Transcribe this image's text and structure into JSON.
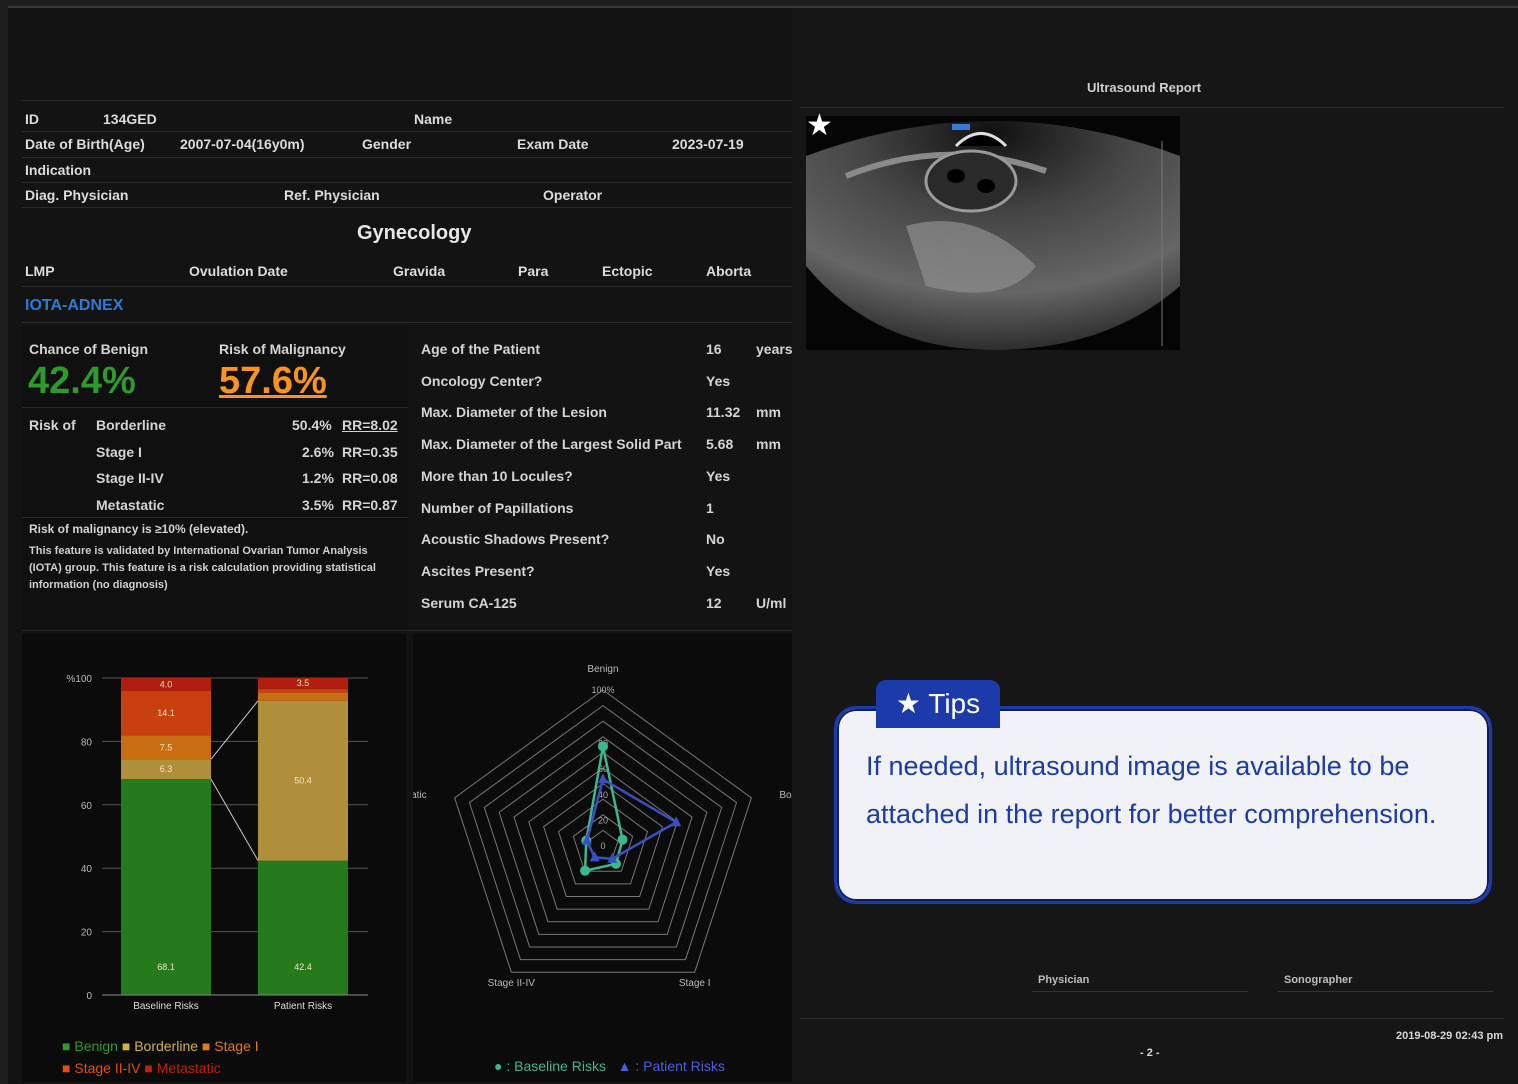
{
  "patient": {
    "id_label": "ID",
    "id_value": "134GED",
    "name_label": "Name",
    "dob_label": "Date of Birth(Age)",
    "dob_value": "2007-07-04(16y0m)",
    "gender_label": "Gender",
    "exam_label": "Exam Date",
    "exam_value": "2023-07-19",
    "indication_label": "Indication",
    "diag_label": "Diag. Physician",
    "ref_label": "Ref. Physician",
    "operator_label": "Operator"
  },
  "section_title": "Gynecology",
  "gyn": {
    "lmp": "LMP",
    "ovulation": "Ovulation Date",
    "gravida": "Gravida",
    "para": "Para",
    "ectopic": "Ectopic",
    "aborta": "Aborta"
  },
  "iota_title": "IOTA-ADNEX",
  "results": {
    "benign_label": "Chance of Benign",
    "benign_value": "42.4%",
    "malig_label": "Risk of Malignancy",
    "malig_value": "57.6%",
    "risk_of": "Risk of",
    "rows": [
      {
        "name": "Borderline",
        "pct": "50.4%",
        "rr": "RR=8.02"
      },
      {
        "name": "Stage I",
        "pct": "2.6%",
        "rr": "RR=0.35"
      },
      {
        "name": "Stage II-IV",
        "pct": "1.2%",
        "rr": "RR=0.08"
      },
      {
        "name": "Metastatic",
        "pct": "3.5%",
        "rr": "RR=0.87"
      }
    ],
    "note": "Risk of malignancy is ≥10% (elevated).",
    "disclaimer": "This feature is validated by International Ovarian Tumor Analysis (IOTA) group. This feature is a risk calculation providing statistical information (no diagnosis)"
  },
  "params": [
    {
      "label": "Age of the Patient",
      "value": "16",
      "unit": "years"
    },
    {
      "label": "Oncology Center?",
      "value": "Yes",
      "unit": ""
    },
    {
      "label": "Max. Diameter of the Lesion",
      "value": "11.32",
      "unit": "mm"
    },
    {
      "label": "Max. Diameter of the Largest Solid Part",
      "value": "5.68",
      "unit": "mm"
    },
    {
      "label": "More than 10 Locules?",
      "value": "Yes",
      "unit": ""
    },
    {
      "label": "Number of Papillations",
      "value": "1",
      "unit": ""
    },
    {
      "label": "Acoustic Shadows Present?",
      "value": "No",
      "unit": ""
    },
    {
      "label": "Ascites Present?",
      "value": "Yes",
      "unit": ""
    },
    {
      "label": "Serum CA-125",
      "value": "12",
      "unit": "U/ml"
    }
  ],
  "bar_legend": {
    "benign": "Benign",
    "borderline": "Borderline",
    "stage1": "Stage I",
    "stage24": "Stage II-IV",
    "metastatic": "Metastatic"
  },
  "radar_legend": {
    "baseline": ": Baseline Risks",
    "patient": ": Patient Risks"
  },
  "right": {
    "report_title": "Ultrasound Report",
    "physician": "Physician",
    "sonographer": "Sonographer",
    "datetime": "2019-08-29 02:43 pm",
    "page": "- 2 -"
  },
  "tips": {
    "label": "★ Tips",
    "text": "If needed, ultrasound image is available to be attached in the report for better comprehension."
  },
  "colors": {
    "benign": "#2e9a2e",
    "malignancy": "#f7941d",
    "iota": "#2e7bd6",
    "tip": "#1c3aa9"
  },
  "chart_data": [
    {
      "type": "bar",
      "categories": [
        "Baseline Risks",
        "Patient Risks"
      ],
      "ylabel_top": "%100",
      "yticks": [
        0,
        20,
        40,
        60,
        80
      ],
      "ylim": [
        0,
        100
      ],
      "series": [
        {
          "name": "Benign",
          "color": "#257a1c",
          "values": [
            68.1,
            42.4
          ]
        },
        {
          "name": "Borderline",
          "color": "#b08f3a",
          "values": [
            6.3,
            50.4
          ]
        },
        {
          "name": "Stage I",
          "color": "#c86d12",
          "values": [
            7.5,
            2.6
          ]
        },
        {
          "name": "Stage II-IV",
          "color": "#c9400f",
          "values": [
            14.1,
            1.2
          ]
        },
        {
          "name": "Metastatic",
          "color": "#b31d10",
          "values": [
            4.0,
            3.5
          ]
        }
      ],
      "labels": {
        "Baseline Risks": [
          "68.1",
          "6.3",
          "7.5",
          "14.1",
          "4.0"
        ],
        "Patient Risks": [
          "42.4",
          "50.4",
          "",
          "",
          "3.5"
        ]
      }
    },
    {
      "type": "radar",
      "axes": [
        "Benign",
        "Borderline",
        "Stage I",
        "Stage II-IV",
        "Metastatic"
      ],
      "ticks": [
        "0",
        "20",
        "40",
        "60",
        "80",
        "100%"
      ],
      "series": [
        {
          "name": "Baseline Risks",
          "color": "#3cb890",
          "values": [
            68.1,
            6.3,
            7.5,
            14.1,
            4.0
          ]
        },
        {
          "name": "Patient Risks",
          "color": "#3b4fc2",
          "values": [
            42.4,
            50.4,
            2.6,
            1.2,
            3.5
          ]
        }
      ]
    }
  ]
}
